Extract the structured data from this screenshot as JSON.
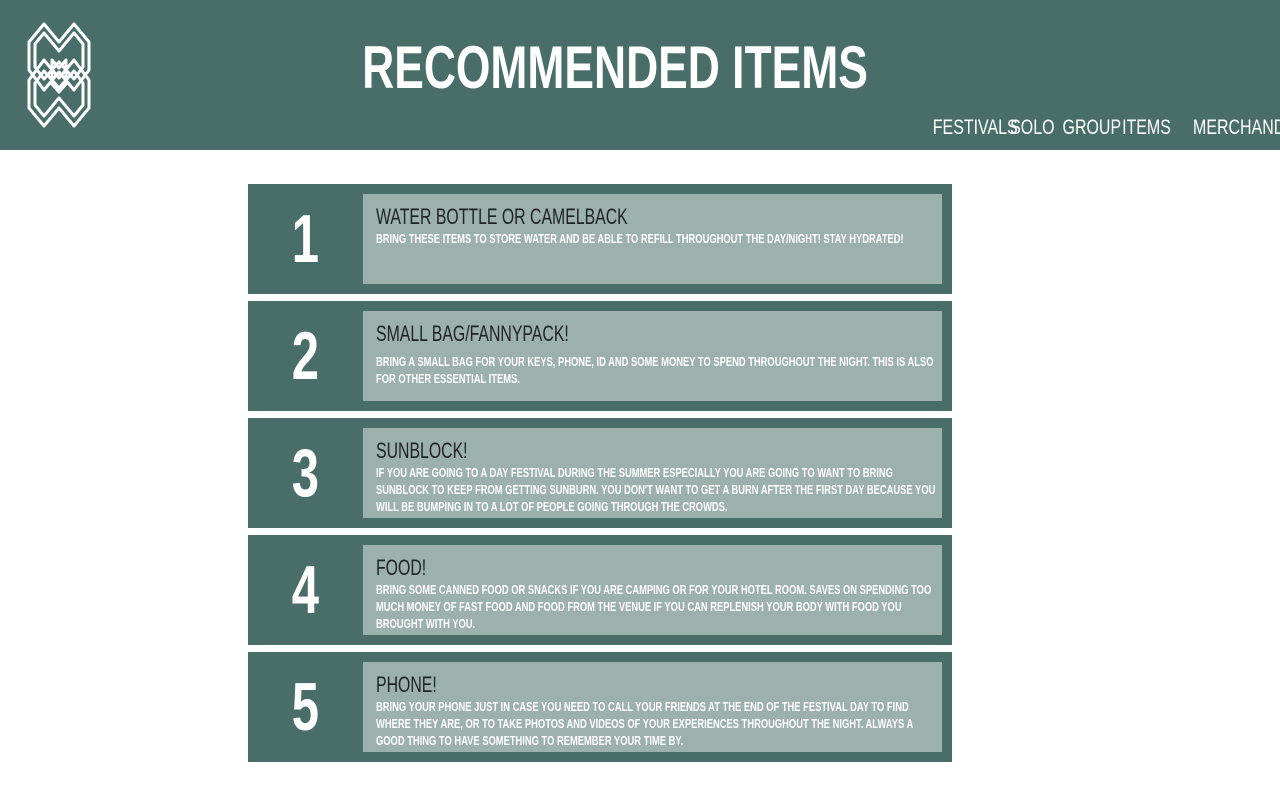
{
  "header": {
    "title": "RECOMMENDED ITEMS",
    "logo_icon": "mw-monogram-logo",
    "background": "#496e6a"
  },
  "nav": {
    "items": [
      {
        "label": "FESTIVALS"
      },
      {
        "label": "SOLO"
      },
      {
        "label": "GROUP"
      },
      {
        "label": "ITEMS"
      },
      {
        "label": "MERCHANDISE"
      }
    ]
  },
  "items": [
    {
      "number": "1",
      "title": "WATER BOTTLE OR CAMELBACK",
      "description": "BRING THESE ITEMS TO STORE WATER AND BE ABLE TO REFILL THROUGHOUT THE DAY/NIGHT! STAY HYDRATED!"
    },
    {
      "number": "2",
      "title": "SMALL BAG/FANNYPACK!",
      "description": "BRING A SMALL BAG FOR YOUR KEYS, PHONE, ID AND SOME MONEY TO SPEND THROUGHOUT THE NIGHT. THIS IS ALSO FOR OTHER ESSENTIAL ITEMS."
    },
    {
      "number": "3",
      "title": "SUNBLOCK!",
      "description": "IF YOU ARE GOING TO A DAY FESTIVAL DURING THE SUMMER ESPECIALLY YOU ARE GOING TO WANT TO BRING SUNBLOCK TO KEEP FROM GETTING SUNBURN. YOU DON'T WANT TO GET A BURN AFTER THE FIRST DAY BECAUSE YOU WILL BE BUMPING IN TO A LOT OF PEOPLE GOING THROUGH THE CROWDS."
    },
    {
      "number": "4",
      "title": "FOOD!",
      "description": "BRING SOME CANNED FOOD OR SNACKS IF YOU ARE CAMPING OR FOR YOUR HOTEL ROOM. SAVES ON SPENDING TOO MUCH MONEY OF FAST FOOD AND FOOD FROM THE VENUE IF YOU CAN REPLENISH YOUR BODY WITH FOOD YOU BROUGHT WITH YOU."
    },
    {
      "number": "5",
      "title": "PHONE!",
      "description": "BRING YOUR PHONE JUST IN CASE YOU NEED TO CALL YOUR FRIENDS AT THE END OF THE FESTIVAL DAY TO FIND WHERE THEY ARE, OR TO TAKE PHOTOS AND VIDEOS OF YOUR EXPERIENCES THROUGHOUT THE NIGHT. ALWAYS A GOOD THING TO HAVE SOMETHING TO REMEMBER YOUR TIME BY."
    }
  ],
  "colors": {
    "card_outer": "#496e6a",
    "card_panel": "#9cb0ae",
    "title_text": "#1d2424",
    "light_text": "#ffffff"
  }
}
